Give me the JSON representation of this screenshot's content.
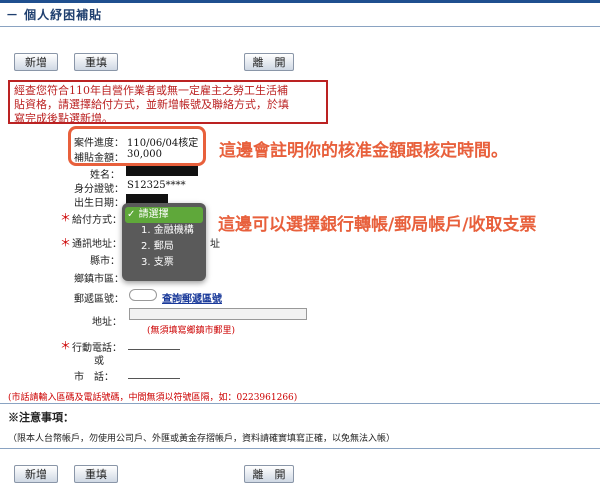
{
  "page": {
    "title": "－ 個人紓困補貼"
  },
  "toolbar": {
    "add_label": "新增",
    "reset_label": "重填",
    "leave_label": "離　開"
  },
  "notice": {
    "line1": "經查您符合110年自營作業者或無一定雇主之勞工生活補",
    "line2": "貼資格，請選擇給付方式，並新增帳號及聯絡方式，於填",
    "line3": "寫完成後點選新增。"
  },
  "case": {
    "progress_label": "案件進度：",
    "progress_value": "110/06/04核定",
    "amount_label": "補貼金額：",
    "amount_value": "30,000"
  },
  "form": {
    "name_label": "姓名：",
    "id_label": "身分證號：",
    "id_value": "S12325****",
    "birth_label": "出生日期：",
    "payment_label": "給付方式：",
    "address_label": "通訊地址：",
    "address_suffix": "址",
    "county_label": "縣市：",
    "town_label": "鄉鎮市區：",
    "zip_label": "郵遞區號：",
    "zip_link": "查詢郵遞區號",
    "addr_label": "地址：",
    "addr_hint": "(無須填寫鄉鎮市郵里)",
    "mobile_label": "行動電話：",
    "or_label": "或",
    "phone_label": "市　話：",
    "phone_hint": "(市話請輸入區碼及電話號碼，中間無須以符號區隔，如：0223961266)"
  },
  "required_mark": "＊",
  "dropdown": {
    "selected": "請選擇",
    "check": "✓",
    "options": [
      "1. 金融機構",
      "2. 郵局",
      "3. 支票"
    ]
  },
  "annotations": {
    "approval": "這邊會註明你的核准金額跟核定時間。",
    "payment": "這邊可以選擇銀行轉帳/郵局帳戶/收取支票"
  },
  "notes": {
    "title": "※注意事項：",
    "text": "（限本人台幣帳戶，勿使用公司戶、外匯或黃金存摺帳戶，資料請確實填寫正確，以免無法入帳）"
  },
  "colors": {
    "accent_red": "#e8603c",
    "notice_red": "#b22222",
    "dropdown_green": "#5fa83a",
    "link_blue": "#1a3a9a"
  }
}
